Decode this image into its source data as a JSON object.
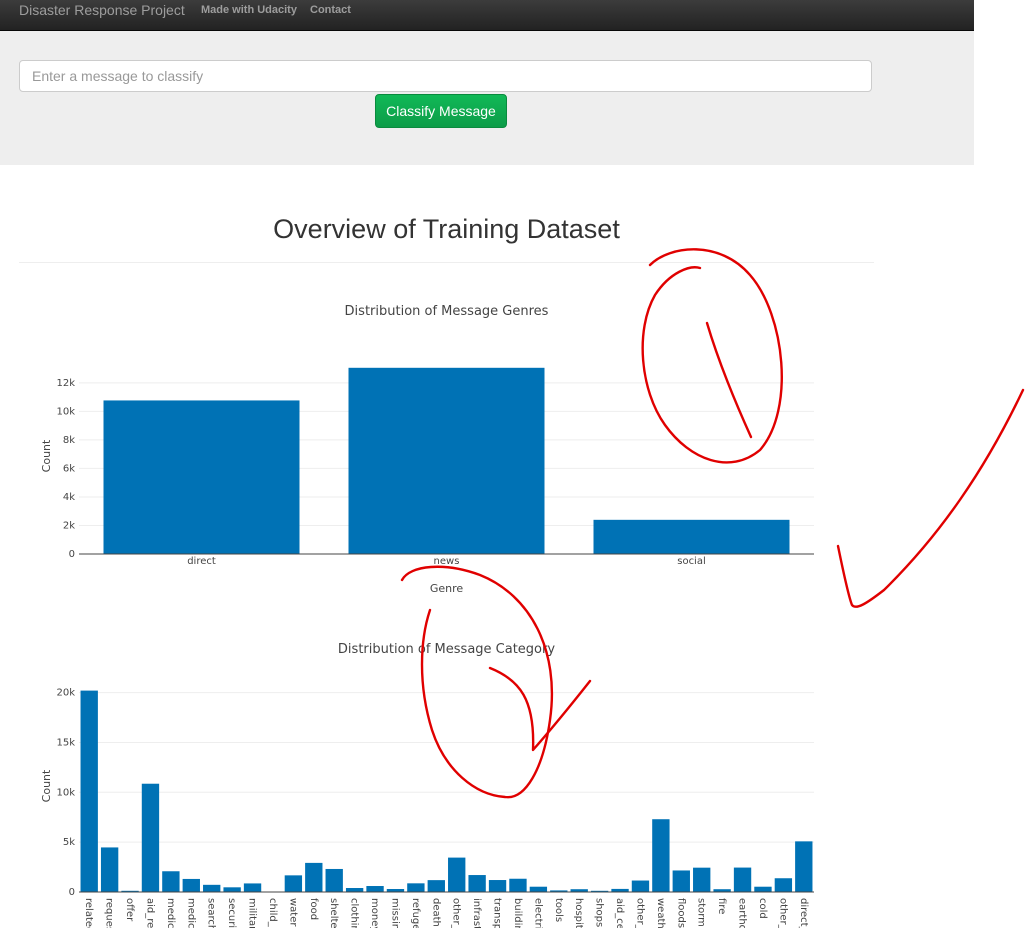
{
  "navbar": {
    "brand": "Disaster Response Project",
    "links": [
      "Made with Udacity",
      "Contact"
    ]
  },
  "search": {
    "placeholder": "Enter a message to classify",
    "button_label": "Classify Message"
  },
  "main": {
    "title": "Overview of Training Dataset"
  },
  "colors": {
    "bar": "#0072b5",
    "button": "#0c9c48",
    "annotation": "#e00000"
  },
  "chart_data": [
    {
      "type": "bar",
      "title": "Distribution of Message Genres",
      "xlabel": "Genre",
      "ylabel": "Count",
      "categories": [
        "direct",
        "news",
        "social"
      ],
      "values": [
        10766,
        13054,
        2396
      ],
      "ylim": [
        0,
        13741
      ],
      "yticks": [
        0,
        2000,
        4000,
        6000,
        8000,
        10000,
        12000
      ],
      "ytick_labels": [
        "0",
        "2k",
        "4k",
        "6k",
        "8k",
        "10k",
        "12k"
      ],
      "grid": true
    },
    {
      "type": "bar",
      "title": "Distribution of Message Category",
      "xlabel": "",
      "ylabel": "Count",
      "categories": [
        "relatec",
        "reques",
        "offer",
        "aid_re",
        "medic",
        "medic",
        "search",
        "securit",
        "militar",
        "child_",
        "water",
        "food",
        "shelter",
        "clothin",
        "money",
        "missin",
        "refuge",
        "death",
        "other_",
        "infrast",
        "transp",
        "buildin",
        "electric",
        "tools",
        "hospita",
        "shops",
        "aid_ce",
        "other_",
        "weathe",
        "floods",
        "storm",
        "fire",
        "earthq",
        "cold",
        "other_",
        "direct_"
      ],
      "values": [
        20200,
        4470,
        120,
        10860,
        2080,
        1310,
        720,
        470,
        860,
        0,
        1670,
        2920,
        2310,
        400,
        600,
        300,
        870,
        1190,
        3450,
        1700,
        1200,
        1330,
        530,
        160,
        280,
        120,
        310,
        1150,
        7300,
        2160,
        2440,
        280,
        2450,
        530,
        1380,
        5080
      ],
      "ylim": [
        0,
        21263
      ],
      "yticks": [
        0,
        5000,
        10000,
        15000,
        20000
      ],
      "ytick_labels": [
        "0",
        "5k",
        "10k",
        "15k",
        "20k"
      ],
      "grid": true
    }
  ]
}
